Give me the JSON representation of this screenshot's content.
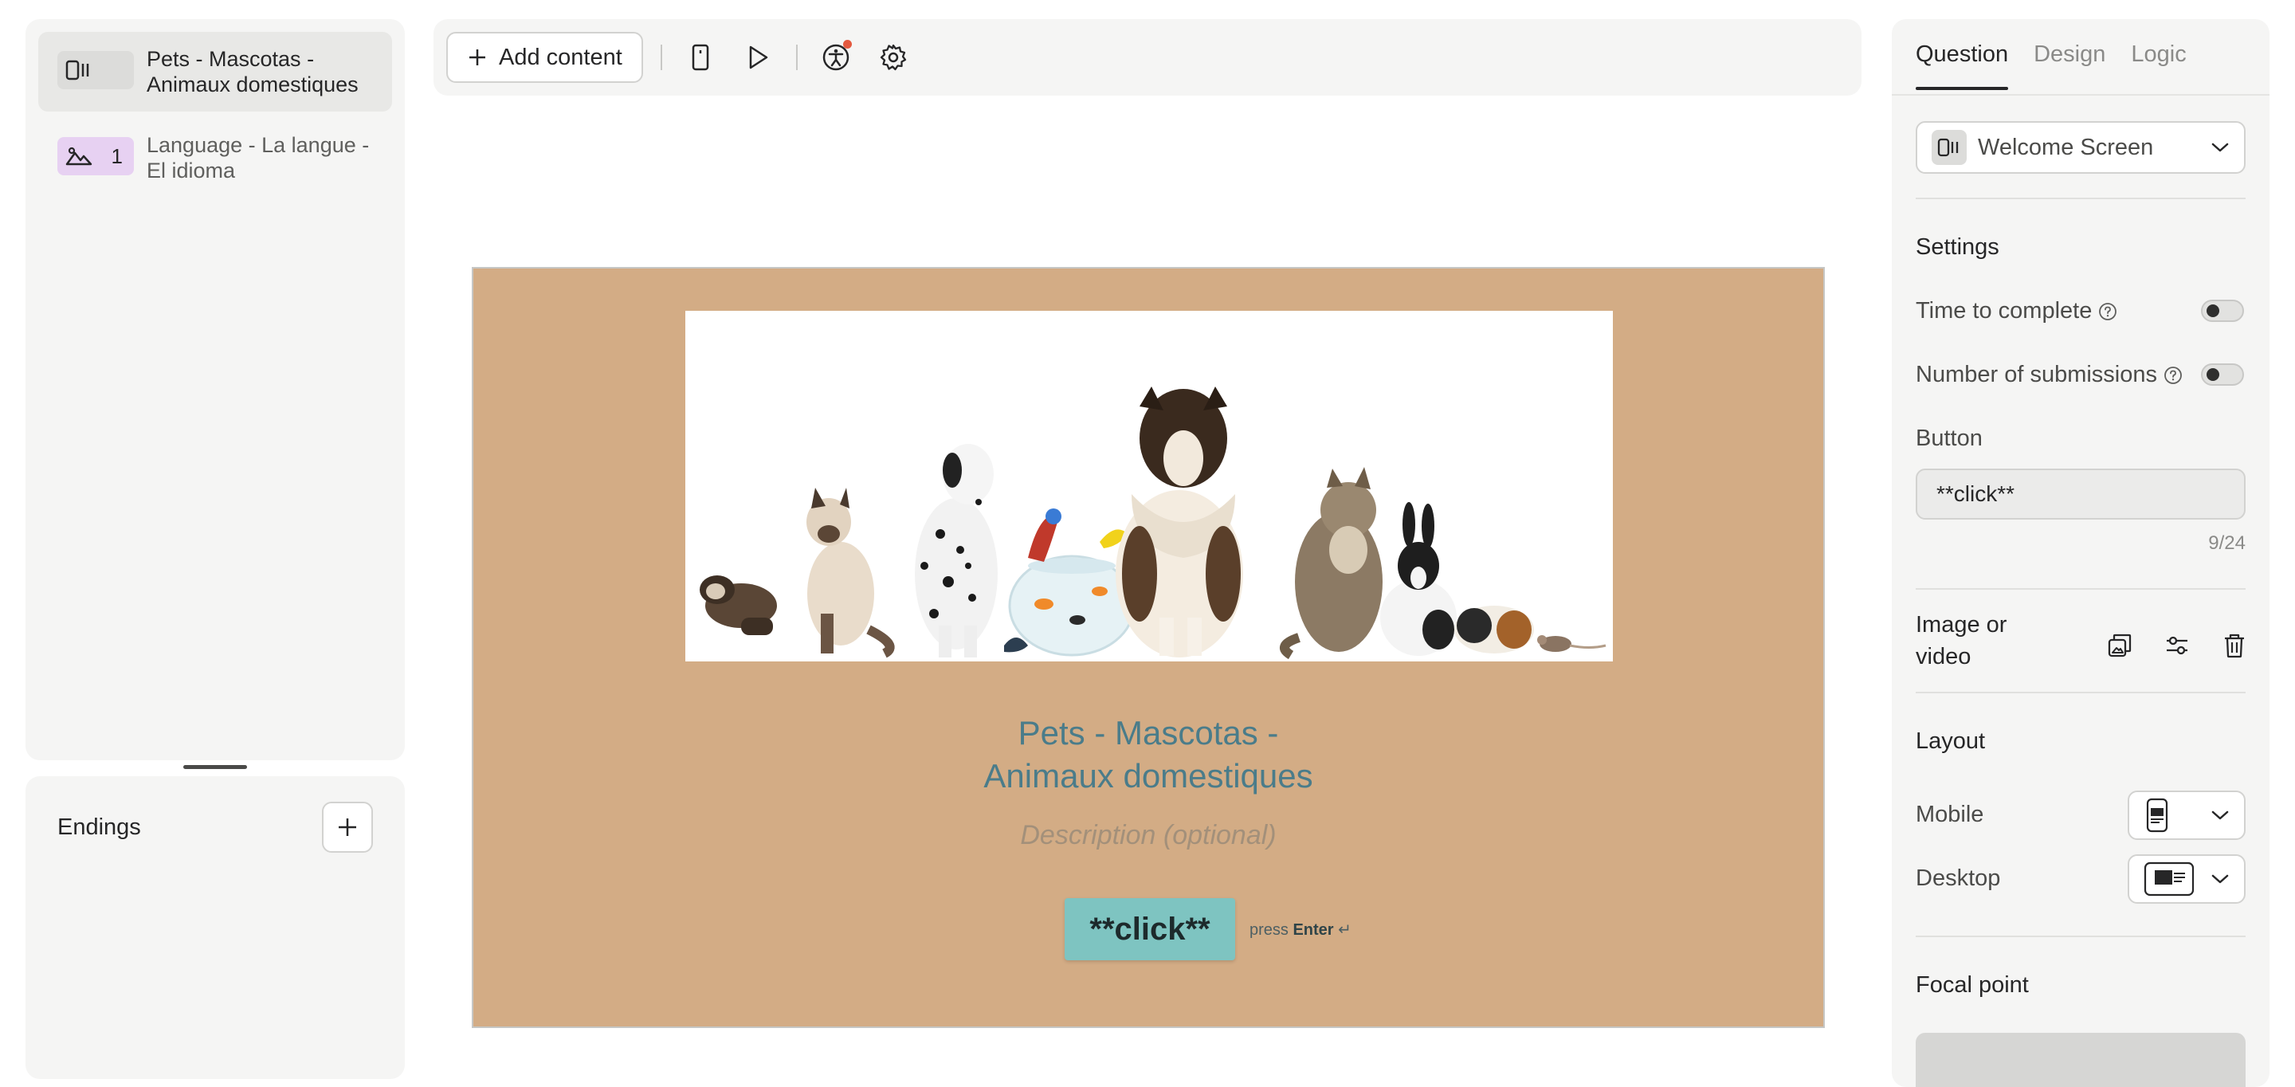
{
  "sidebar": {
    "items": [
      {
        "label": "Pets - Mascotas - Animaux domestiques",
        "number": "",
        "icon": "welcome-screen-icon",
        "active": true
      },
      {
        "label": "Language - La langue - El idioma",
        "number": "1",
        "icon": "picture-choice-icon",
        "active": false
      }
    ],
    "endings_title": "Endings"
  },
  "toolbar": {
    "add_content_label": "Add content",
    "icons": [
      "mobile-preview-icon",
      "play-icon",
      "accessibility-icon",
      "settings-gear-icon"
    ]
  },
  "canvas": {
    "title": "Pets - Mascotas - Animaux domestiques",
    "description_placeholder": "Description (optional)",
    "button_label": "**click**",
    "press_hint_prefix": "press",
    "press_hint_key": "Enter",
    "press_hint_symbol": "↵",
    "background_color": "#d3ac85",
    "button_color": "#7ec4c1",
    "title_color": "#4a7c8a"
  },
  "panel": {
    "tabs": [
      {
        "label": "Question",
        "active": true
      },
      {
        "label": "Design",
        "active": false
      },
      {
        "label": "Logic",
        "active": false
      }
    ],
    "question_type": "Welcome Screen",
    "settings_title": "Settings",
    "time_to_complete_label": "Time to complete",
    "time_to_complete_enabled": false,
    "submissions_label": "Number of submissions",
    "submissions_enabled": false,
    "button_section_label": "Button",
    "button_value": "**click**",
    "char_count": "9/24",
    "image_label": "Image or video",
    "layout_title": "Layout",
    "mobile_label": "Mobile",
    "desktop_label": "Desktop",
    "focal_point_title": "Focal point"
  }
}
